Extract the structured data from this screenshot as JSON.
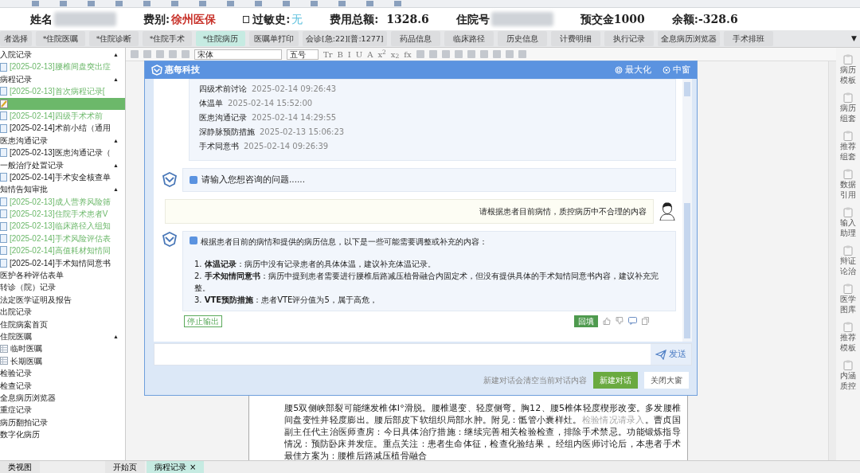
{
  "patient_bar": [
    {
      "kind": "redacted",
      "label": "姓名"
    },
    {
      "kind": "value",
      "label": "费别:",
      "value": "徐州医保",
      "color": "#c8322a"
    },
    {
      "kind": "check",
      "label": "过敏史:",
      "value": "无",
      "checked": false,
      "color": "#5bc0de"
    },
    {
      "kind": "text",
      "label": "费用总额:  1328.6"
    },
    {
      "kind": "redacted",
      "label": "住院号"
    },
    {
      "kind": "text",
      "label": "预交金1000"
    },
    {
      "kind": "text",
      "label": "余额:-328.6"
    }
  ],
  "tabs": [
    {
      "label": "者选择",
      "selected": false
    },
    {
      "label": "*住院医嘱",
      "selected": false
    },
    {
      "label": "*住院诊断",
      "selected": false
    },
    {
      "label": "*住院手术",
      "selected": false
    },
    {
      "label": "*住院病历",
      "selected": true
    },
    {
      "label": "医嘱单打印",
      "selected": false
    },
    {
      "label": "会诊[急:22][普:1277]",
      "selected": false
    },
    {
      "label": "药品信息",
      "selected": false
    },
    {
      "label": "临床路径",
      "selected": false
    },
    {
      "label": "历史信息",
      "selected": false
    },
    {
      "label": "计费明细",
      "selected": false
    },
    {
      "label": "执行记录",
      "selected": false
    },
    {
      "label": "全息病历浏览器",
      "selected": false
    },
    {
      "label": "手术排班",
      "selected": false
    }
  ],
  "tabs_more": "▼",
  "tree": [
    {
      "label": "入院记录",
      "caret": "▲",
      "expanded": true,
      "children": [
        {
          "label": "[2025-02-13]腰椎间盘突出症",
          "color": "#6cb86a",
          "selected": false,
          "kind": "doc"
        }
      ]
    },
    {
      "label": "病程记录",
      "caret": "▲",
      "expanded": true,
      "children": [
        {
          "label": "[2025-02-13]首次病程记录[",
          "color": "#6cb86a",
          "selected": false,
          "kind": "doc"
        },
        {
          "color": "#6cb86a",
          "selected": true,
          "kind": "edit"
        },
        {
          "label": "[2025-02-14]四级手术术前",
          "color": "#6cb86a",
          "selected": false,
          "kind": "doc"
        },
        {
          "label": "[2025-02-14]术前小结（通用",
          "selected": false,
          "kind": "doc"
        }
      ]
    },
    {
      "label": "医患沟通记录",
      "caret": "▲",
      "expanded": true,
      "children": [
        {
          "label": "[2025-02-13]医患沟通记录（",
          "selected": false,
          "kind": "doc"
        }
      ]
    },
    {
      "label": "一般治疗处置记录",
      "caret": "▲",
      "expanded": true,
      "children": [
        {
          "label": "[2025-02-14]手术安全核查单",
          "selected": false,
          "kind": "doc"
        }
      ]
    },
    {
      "label": "知情告知审批",
      "caret": "▲",
      "expanded": true,
      "children": [
        {
          "label": "[2025-02-13]成人营养风险筛",
          "color": "#6cb86a",
          "selected": false,
          "kind": "doc"
        },
        {
          "label": "[2025-02-13]住院手术患者V",
          "color": "#6cb86a",
          "selected": false,
          "kind": "doc"
        },
        {
          "label": "[2025-02-13]临床路径入组知",
          "color": "#6cb86a",
          "selected": false,
          "kind": "doc"
        },
        {
          "label": "[2025-02-14]手术风险评估表",
          "color": "#6cb86a",
          "selected": false,
          "kind": "doc"
        },
        {
          "label": "[2025-02-14]高值耗材知情同",
          "color": "#6cb86a",
          "selected": false,
          "kind": "doc"
        },
        {
          "label": "[2025-02-14]手术知情同意书",
          "selected": false,
          "kind": "doc"
        }
      ]
    },
    {
      "label": "医护各种评估表单"
    },
    {
      "label": "转诊（院）记录"
    },
    {
      "label": "法定医学证明及报告"
    },
    {
      "label": "出院记录"
    },
    {
      "label": "住院病案首页"
    },
    {
      "label": "住院医嘱",
      "caret": "▲",
      "expanded": true,
      "children": [
        {
          "label": "临时医嘱",
          "selected": false,
          "kind": "sheet"
        },
        {
          "label": "长期医嘱",
          "selected": false,
          "kind": "sheet"
        }
      ]
    },
    {
      "label": "检验记录"
    },
    {
      "label": "检查记录"
    },
    {
      "label": "全息病历浏览器"
    },
    {
      "label": "重症记录"
    },
    {
      "label": "病历翻拍记录"
    },
    {
      "label": "数字化病历"
    }
  ],
  "editor_toolbar": {
    "font": "宋体",
    "size": "五号",
    "buttons": [
      "Tr",
      "B",
      "I",
      "U",
      "A",
      "x$^{2}$",
      "x$_{2}$",
      "fx"
    ]
  },
  "document": [
    {
      "kind": "text",
      "text": "腰5双侧峡部裂可能继发椎体I°滑脱。腰椎退变、轻度侧弯。胸12、腰5椎体轻度楔形改变。多发腰椎间盘变性并轻度膨出。腰后部皮下软组织局部水肿。附见：骶管小囊样灶。"
    },
    {
      "kind": "placeholder",
      "text": "检验情况请录入"
    },
    {
      "kind": "text",
      "text": "。曹贞国副主任代主治医师查房：今日具体治疗措施：继续完善相关检验检查，排除手术禁忌。功能锻炼指导情况：预防卧床并发症。重点关注：患者生命体征，检查化验结果 。经组内医师讨论后，本患者手术最佳方案为：腰椎后路减压植骨融合"
    }
  ],
  "right_tools": [
    "病历模板",
    "病历组套",
    "推荐组套",
    "数据引用",
    "输入助理",
    "辩证论治",
    "医学图库",
    "推荐模板",
    "内涵质控"
  ],
  "bottom_tabs": [
    {
      "label": "类视图",
      "selected": false
    },
    {
      "label": "开始页",
      "selected": false
    },
    {
      "label": "病程记录",
      "selected": true,
      "close": "×"
    }
  ],
  "assistant": {
    "logo": "惠每科技",
    "maximize": "最大化",
    "medium": "中窗",
    "records": [
      {
        "name": "四级术前讨论",
        "time": "2025-02-14 09:26:43"
      },
      {
        "name": "体温单",
        "time": "2025-02-14 15:52:00"
      },
      {
        "name": "医患沟通记录",
        "time": "2025-02-14 14:29:55"
      },
      {
        "name": "深静脉预防措施",
        "time": "2025-02-13 15:06:23"
      },
      {
        "name": "手术同意书",
        "time": "2025-02-14 09:26:39"
      }
    ],
    "prompt": "请输入您想咨询的问题......",
    "question": "请根据患者目前病情，质控病历中不合理的内容",
    "answer": [
      "根据患者目前的病情和提供的病历信息，以下是一些可能需要调整或补充的内容：",
      "1. **体温记录**：病历中没有记录患者的具体体温，建议补充体温记录。",
      "2. **手术知情同意书**：病历中提到患者需要进行腰椎后路减压植骨融合内固定术，但没有提供具体的手术知情同意书内容，建议补充完整。",
      "3. **VTE预防措施**：患者VTE评分值为5，属于高危，"
    ],
    "stop": "停止输出",
    "fill": "回填",
    "send": "发送",
    "new_hint": "新建对话会清空当前对话内容",
    "new_chat": "新建对话",
    "close": "关闭大窗"
  }
}
